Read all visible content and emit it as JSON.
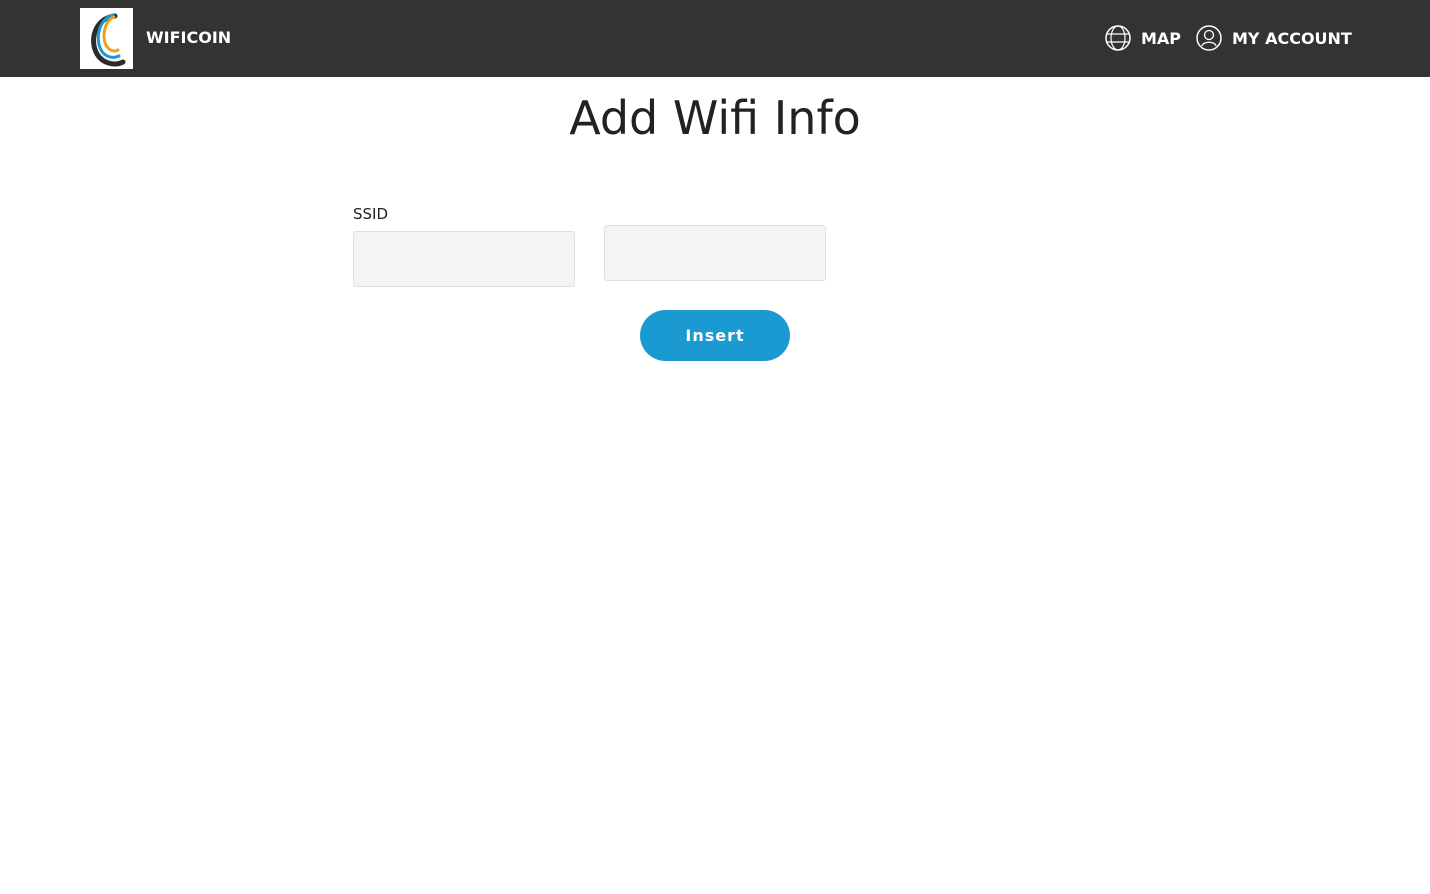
{
  "header": {
    "logo_icon": "swirl-logo-icon",
    "brand": "WIFICOIN",
    "nav": {
      "map": {
        "label": "MAP",
        "icon": "globe-icon"
      },
      "account": {
        "label": "MY ACCOUNT",
        "icon": "user-circle-icon"
      }
    }
  },
  "main": {
    "title": "Add Wifi Info",
    "ssid_label": "SSID",
    "ssid_value": "",
    "second_value": "",
    "insert_label": "Insert"
  },
  "colors": {
    "navbar": "#333333",
    "accent": "#1b9ad1",
    "logo_orange": "#f0a020",
    "logo_blue": "#1b9ad1",
    "logo_dark": "#2b2b2b"
  }
}
